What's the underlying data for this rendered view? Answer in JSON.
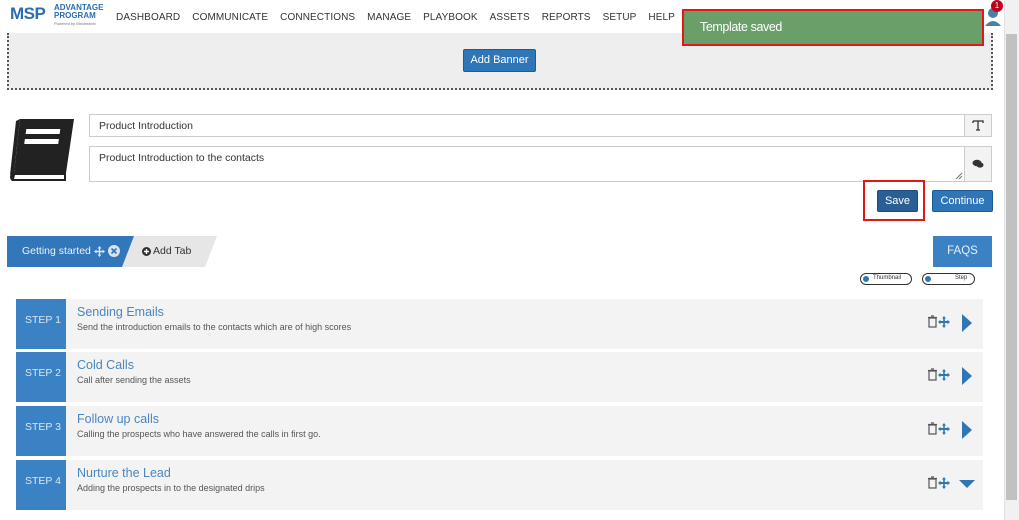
{
  "logo": {
    "msp": "MSP",
    "line1": "ADVANTAGE",
    "line2": "PROGRAM",
    "powered": "Powered by Mindmatrix"
  },
  "nav": [
    "DASHBOARD",
    "COMMUNICATE",
    "CONNECTIONS",
    "MANAGE",
    "PLAYBOOK",
    "ASSETS",
    "REPORTS",
    "SETUP",
    "HELP"
  ],
  "notification": {
    "count": "1"
  },
  "toast": {
    "message": "Template saved"
  },
  "banner": {
    "button": "Add Banner"
  },
  "form": {
    "title_value": "Product Introduction",
    "description_value": "Product Introduction to the contacts",
    "save_label": "Save",
    "continue_label": "Continue"
  },
  "tabs": {
    "active_label": "Getting started",
    "add_label": "Add Tab",
    "faqs_label": "FAQS"
  },
  "toggles": {
    "thumbnail": "Thumbnail",
    "step": "Step"
  },
  "steps": [
    {
      "label": "STEP",
      "num": "1",
      "title": "Sending Emails",
      "desc": "Send the introduction emails to the contacts which are of high scores",
      "expanded": false
    },
    {
      "label": "STEP",
      "num": "2",
      "title": "Cold Calls",
      "desc": "Call after sending the assets",
      "expanded": false
    },
    {
      "label": "STEP",
      "num": "3",
      "title": "Follow up calls",
      "desc": "Calling the prospects who have answered the calls in first go.",
      "expanded": false
    },
    {
      "label": "STEP",
      "num": "4",
      "title": "Nurture the Lead",
      "desc": "Adding the prospects in to the designated drips",
      "expanded": true
    }
  ],
  "colors": {
    "primary": "#2f76b9",
    "toast": "#6a9f6a",
    "highlight": "#e01818"
  }
}
